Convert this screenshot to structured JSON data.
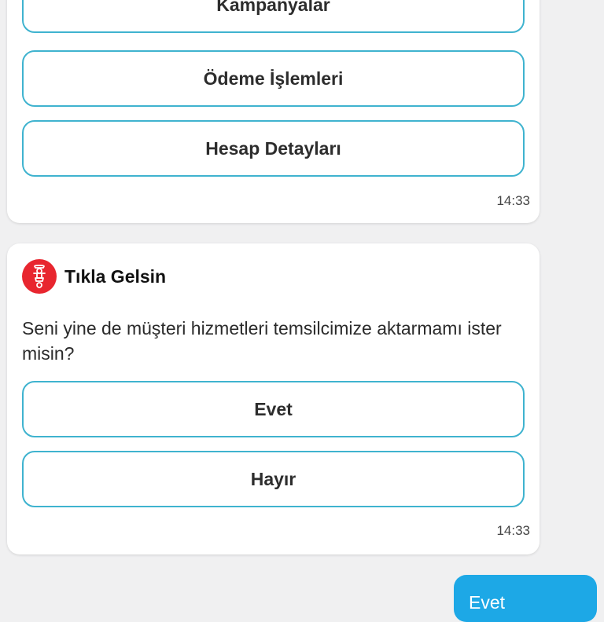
{
  "chat": {
    "menu_card": {
      "options": [
        "Kampanyalar",
        "Ödeme İşlemleri",
        "Hesap Detayları"
      ],
      "time": "14:33"
    },
    "bot_card": {
      "bot_name": "Tıkla Gelsin",
      "avatar_icon": "scooter-courier-icon",
      "avatar_color": "#e8262f",
      "message": "Seni yine de müşteri hizmetleri temsilcimize aktarmamı ister misin?",
      "options": [
        "Evet",
        "Hayır"
      ],
      "time": "14:33"
    },
    "user_message": {
      "text": "Evet",
      "color": "#1da8e6"
    }
  },
  "colors": {
    "option_border": "#3fb3cf",
    "background": "#f0f0f1"
  }
}
